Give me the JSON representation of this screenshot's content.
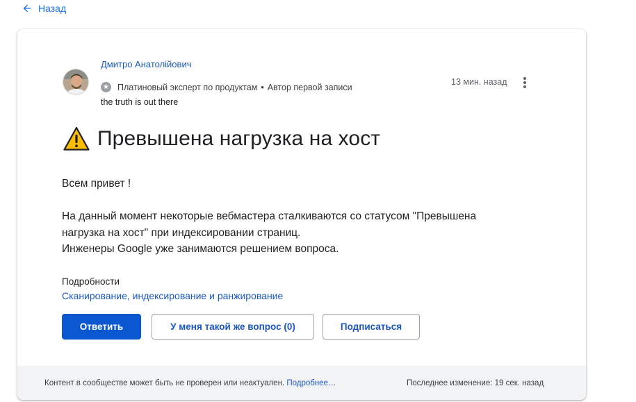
{
  "nav": {
    "back_label": "Назад"
  },
  "post": {
    "author": {
      "name": "Дмитро Анатолійович",
      "role": "Платиновый эксперт по продуктам",
      "role_badge_icon": "star-badge-icon",
      "separator": "•",
      "extra_role": "Автор первой записи",
      "tagline": "the truth is out there"
    },
    "time_ago": "13 мин. назад",
    "title": "Превышена нагрузка на хост",
    "title_icon": "warning-icon",
    "body": {
      "greeting": "Всем привет !",
      "line1": "На данный момент некоторые вебмастера сталкиваются со статусом \"Превышена",
      "line2": "нагрузка на хост\" при индексировании страниц.",
      "line3": "Инженеры Google уже занимаются решением вопроса."
    },
    "details": {
      "label": "Подробности",
      "category": "Сканирование, индексирование и ранжирование"
    },
    "actions": {
      "reply": "Ответить",
      "same_question": "У меня такой же вопрос (0)",
      "subscribe": "Подписаться"
    }
  },
  "footer": {
    "disclaimer": "Контент в сообществе может быть не проверен или неактуален.",
    "more_link": "Подробнее…",
    "last_modified": "Последнее изменение: 19 сек. назад"
  },
  "colors": {
    "primary": "#0b57d0",
    "link": "#1a57c4",
    "warning_yellow": "#fbbc04",
    "footer_bg": "#f1f3f4"
  }
}
